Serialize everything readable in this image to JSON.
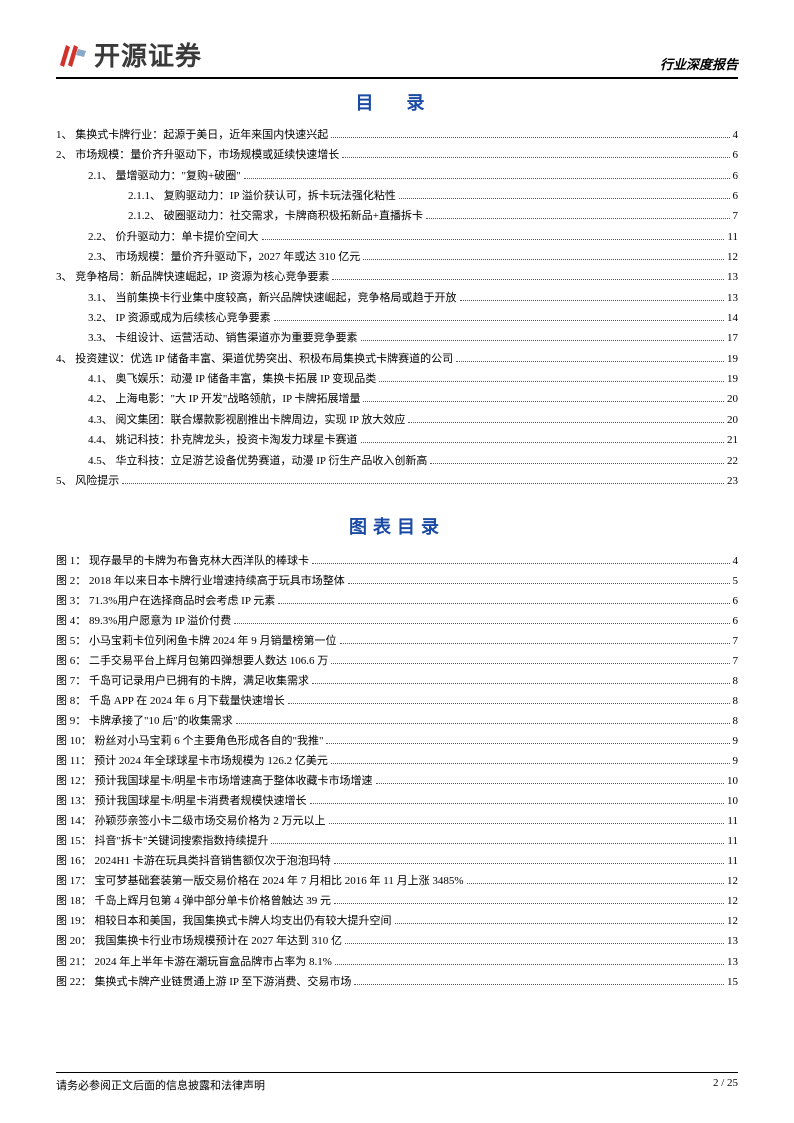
{
  "header": {
    "brand": "开源证券",
    "report_type": "行业深度报告"
  },
  "toc_heading": "目  录",
  "fig_heading": "图表目录",
  "footer": {
    "disclaimer": "请务必参阅正文后面的信息披露和法律声明",
    "page": "2 / 25"
  },
  "toc": [
    {
      "level": 0,
      "num": "1、",
      "title": "集换式卡牌行业：起源于美日，近年来国内快速兴起",
      "page": "4"
    },
    {
      "level": 0,
      "num": "2、",
      "title": "市场规模：量价齐升驱动下，市场规模或延续快速增长",
      "page": "6"
    },
    {
      "level": 1,
      "num": "2.1、",
      "title": "量增驱动力：\"复购+破圈\"",
      "page": "6"
    },
    {
      "level": 2,
      "num": "2.1.1、",
      "title": "复购驱动力：IP 溢价获认可，拆卡玩法强化粘性",
      "page": "6"
    },
    {
      "level": 2,
      "num": "2.1.2、",
      "title": "破圈驱动力：社交需求，卡牌商积极拓新品+直播拆卡",
      "page": "7"
    },
    {
      "level": 1,
      "num": "2.2、",
      "title": "价升驱动力：单卡提价空间大",
      "page": "11"
    },
    {
      "level": 1,
      "num": "2.3、",
      "title": "市场规模：量价齐升驱动下，2027 年或达 310 亿元",
      "page": "12"
    },
    {
      "level": 0,
      "num": "3、",
      "title": "竞争格局：新品牌快速崛起，IP 资源为核心竞争要素",
      "page": "13"
    },
    {
      "level": 1,
      "num": "3.1、",
      "title": "当前集换卡行业集中度较高，新兴品牌快速崛起，竞争格局或趋于开放",
      "page": "13"
    },
    {
      "level": 1,
      "num": "3.2、",
      "title": "IP 资源或成为后续核心竞争要素",
      "page": "14"
    },
    {
      "level": 1,
      "num": "3.3、",
      "title": "卡组设计、运营活动、销售渠道亦为重要竞争要素",
      "page": "17"
    },
    {
      "level": 0,
      "num": "4、",
      "title": "投资建议：优选 IP 储备丰富、渠道优势突出、积极布局集换式卡牌赛道的公司",
      "page": "19"
    },
    {
      "level": 1,
      "num": "4.1、",
      "title": "奥飞娱乐：动漫 IP 储备丰富，集换卡拓展 IP 变现品类",
      "page": "19"
    },
    {
      "level": 1,
      "num": "4.2、",
      "title": "上海电影：\"大 IP 开发\"战略领航，IP 卡牌拓展增量",
      "page": "20"
    },
    {
      "level": 1,
      "num": "4.3、",
      "title": "阅文集团：联合爆款影视剧推出卡牌周边，实现 IP 放大效应",
      "page": "20"
    },
    {
      "level": 1,
      "num": "4.4、",
      "title": "姚记科技：扑克牌龙头，投资卡淘发力球星卡赛道",
      "page": "21"
    },
    {
      "level": 1,
      "num": "4.5、",
      "title": "华立科技：立足游艺设备优势赛道，动漫 IP 衍生产品收入创新高",
      "page": "22"
    },
    {
      "level": 0,
      "num": "5、",
      "title": "风险提示",
      "page": "23"
    }
  ],
  "figures": [
    {
      "num": "图 1：",
      "title": "现存最早的卡牌为布鲁克林大西洋队的棒球卡",
      "page": "4"
    },
    {
      "num": "图 2：",
      "title": "2018 年以来日本卡牌行业增速持续高于玩具市场整体",
      "page": "5"
    },
    {
      "num": "图 3：",
      "title": "71.3%用户在选择商品时会考虑 IP 元素",
      "page": "6"
    },
    {
      "num": "图 4：",
      "title": "89.3%用户愿意为 IP 溢价付费",
      "page": "6"
    },
    {
      "num": "图 5：",
      "title": "小马宝莉卡位列闲鱼卡牌 2024 年 9 月销量榜第一位",
      "page": "7"
    },
    {
      "num": "图 6：",
      "title": "二手交易平台上辉月包第四弹想要人数达 106.6 万",
      "page": "7"
    },
    {
      "num": "图 7：",
      "title": "千岛可记录用户已拥有的卡牌，满足收集需求",
      "page": "8"
    },
    {
      "num": "图 8：",
      "title": "千岛 APP 在 2024 年 6 月下载量快速增长",
      "page": "8"
    },
    {
      "num": "图 9：",
      "title": "卡牌承接了\"10 后\"的收集需求",
      "page": "8"
    },
    {
      "num": "图 10：",
      "title": "粉丝对小马宝莉 6 个主要角色形成各自的\"我推\"",
      "page": "9"
    },
    {
      "num": "图 11：",
      "title": "预计 2024 年全球球星卡市场规模为 126.2 亿美元",
      "page": "9"
    },
    {
      "num": "图 12：",
      "title": "预计我国球星卡/明星卡市场增速高于整体收藏卡市场增速",
      "page": "10"
    },
    {
      "num": "图 13：",
      "title": "预计我国球星卡/明星卡消费者规模快速增长",
      "page": "10"
    },
    {
      "num": "图 14：",
      "title": "孙颖莎亲签小卡二级市场交易价格为 2 万元以上",
      "page": "11"
    },
    {
      "num": "图 15：",
      "title": "抖音\"拆卡\"关键词搜索指数持续提升",
      "page": "11"
    },
    {
      "num": "图 16：",
      "title": "2024H1 卡游在玩具类抖音销售额仅次于泡泡玛特",
      "page": "11"
    },
    {
      "num": "图 17：",
      "title": "宝可梦基础套装第一版交易价格在 2024 年 7 月相比 2016 年 11 月上涨 3485%",
      "page": "12"
    },
    {
      "num": "图 18：",
      "title": "千岛上辉月包第 4 弹中部分单卡价格曾触达 39 元",
      "page": "12"
    },
    {
      "num": "图 19：",
      "title": "相较日本和美国，我国集换式卡牌人均支出仍有较大提升空间",
      "page": "12"
    },
    {
      "num": "图 20：",
      "title": "我国集换卡行业市场规模预计在 2027 年达到 310 亿",
      "page": "13"
    },
    {
      "num": "图 21：",
      "title": "2024 年上半年卡游在潮玩盲盒品牌市占率为 8.1%",
      "page": "13"
    },
    {
      "num": "图 22：",
      "title": "集换式卡牌产业链贯通上游 IP 至下游消费、交易市场",
      "page": "15"
    }
  ]
}
